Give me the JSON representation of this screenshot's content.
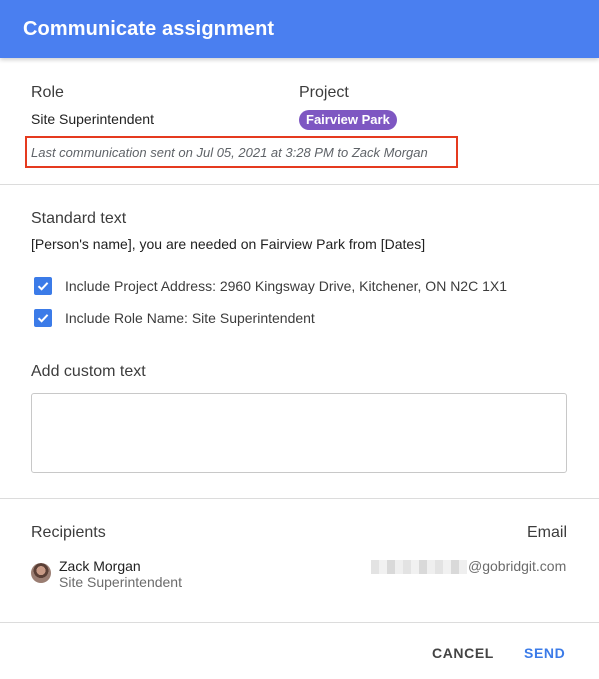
{
  "header": {
    "title": "Communicate assignment"
  },
  "assignment": {
    "role_label": "Role",
    "role_value": "Site Superintendent",
    "project_label": "Project",
    "project_value": "Fairview Park",
    "last_communication": "Last communication sent on Jul 05, 2021 at 3:28 PM to Zack Morgan"
  },
  "standard_text": {
    "label": "Standard text",
    "message": "[Person's name], you are needed on Fairview Park from [Dates]",
    "options": [
      {
        "label": "Include Project Address: 2960 Kingsway Drive, Kitchener, ON N2C 1X1",
        "checked": true
      },
      {
        "label": "Include Role Name: Site Superintendent",
        "checked": true
      }
    ]
  },
  "custom_text": {
    "label": "Add custom text",
    "value": "",
    "placeholder": ""
  },
  "recipients": {
    "label": "Recipients",
    "email_label": "Email",
    "items": [
      {
        "name": "Zack Morgan",
        "role": "Site Superintendent",
        "email_domain": "@gobridgit.com"
      }
    ]
  },
  "actions": {
    "cancel_label": "CANCEL",
    "send_label": "SEND"
  },
  "colors": {
    "header": "#4a7ff0",
    "project_chip": "#7e57c2",
    "checkbox": "#3b7be8",
    "highlight_border": "#e53a1f",
    "send_button": "#3b7be8"
  }
}
